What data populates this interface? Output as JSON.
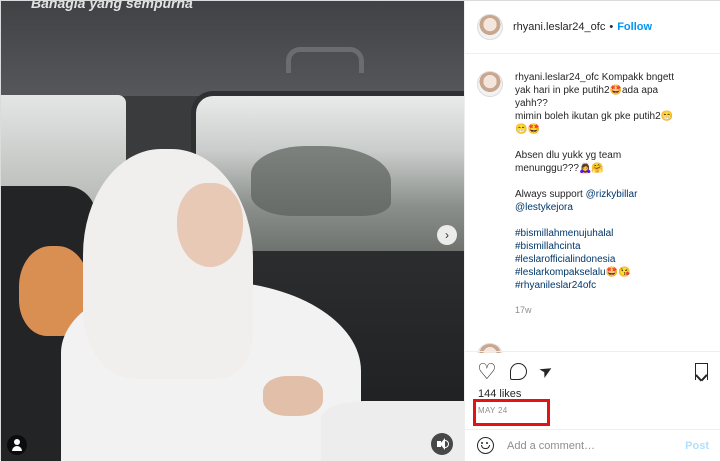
{
  "media": {
    "top_caption": "Bahagia yang sempurna",
    "next_glyph": "›"
  },
  "header": {
    "username": "rhyani.leslar24_ofc",
    "separator": "•",
    "follow_label": "Follow"
  },
  "caption": {
    "username": "rhyani.leslar24_ofc",
    "lines": [
      "Kompakk bngett",
      "yak hari in pke putih2🤩ada apa",
      "yahh??",
      "mimin boleh ikutan gk pke putih2😁",
      "😁🤩"
    ],
    "lines2": [
      "Absen dlu yukk yg team",
      "menunggu???🙇‍♀️🤗"
    ],
    "support_prefix": "Always support ",
    "mention_1": "@rizkybillar",
    "mention_2": "@lestykejora",
    "hashtags": [
      "#bismillahmenujuhalal",
      "#bismillahcinta",
      "#leslarofficialindonesia",
      "#leslarkompakselalu🤩😘",
      "#rhyanileslar24ofc"
    ],
    "time": "17w"
  },
  "actions": {
    "like_icon": "heart-icon",
    "comment_icon": "comment-icon",
    "share_icon": "share-icon",
    "save_icon": "save-icon"
  },
  "likes": "144 likes",
  "post_date": "MAY 24",
  "add_comment": {
    "placeholder": "Add a comment…",
    "post_label": "Post"
  },
  "colors": {
    "link": "#0095f6",
    "tag": "#00376b",
    "highlight_box": "#e31313"
  }
}
